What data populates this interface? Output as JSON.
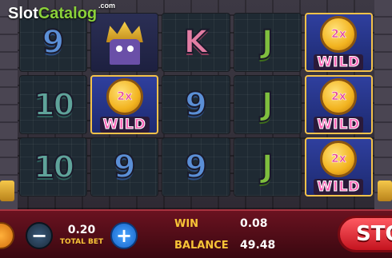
{
  "logo": {
    "slot": "Slot",
    "catalog": "Catalog",
    "com": ".com"
  },
  "reels": [
    [
      "9",
      "bonus",
      "K",
      "J",
      "wild"
    ],
    [
      "10",
      "wild",
      "9",
      "J",
      "wild"
    ],
    [
      "10",
      "9",
      "9",
      "J",
      "wild"
    ]
  ],
  "wild": {
    "multiplier": "2x",
    "label": "WILD"
  },
  "bet": {
    "value": "0.20",
    "label": "TOTAL BET"
  },
  "win": {
    "label": "WIN",
    "value": "0.08"
  },
  "balance": {
    "label": "BALANCE",
    "value": "49.48"
  },
  "buttons": {
    "minus": "−",
    "plus": "+",
    "stop": "STOP"
  },
  "colors": {
    "bar": "#6a1220",
    "gold_text": "#f7c437",
    "stop": "#e0232d",
    "plus": "#1e7ae6"
  }
}
